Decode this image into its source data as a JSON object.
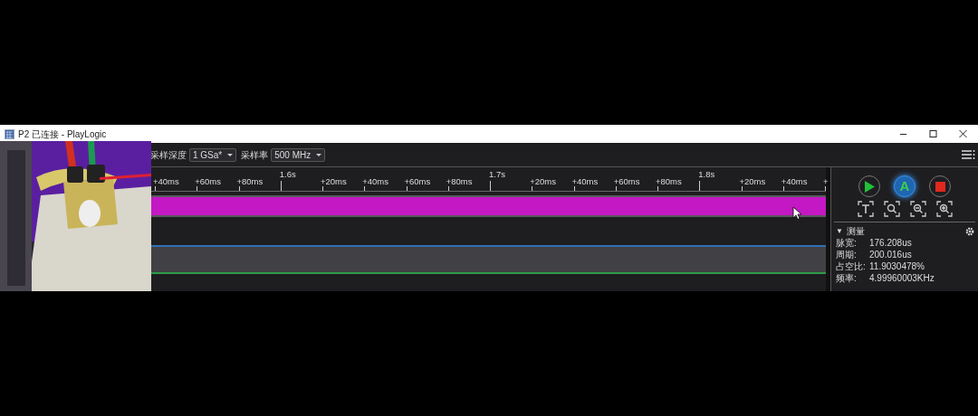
{
  "window": {
    "title": "P2 已连接 - PlayLogic"
  },
  "toolbar": {
    "fields": [
      {
        "label": "采样深度",
        "value": "1 GSa*"
      },
      {
        "label": "采样率",
        "value": "500 MHz"
      }
    ]
  },
  "ruler": {
    "ticks": [
      {
        "kind": "minor",
        "label": "+40ms"
      },
      {
        "kind": "minor",
        "label": "+60ms"
      },
      {
        "kind": "minor",
        "label": "+80ms"
      },
      {
        "kind": "major",
        "label": "1.6s"
      },
      {
        "kind": "minor",
        "label": "+20ms"
      },
      {
        "kind": "minor",
        "label": "+40ms"
      },
      {
        "kind": "minor",
        "label": "+60ms"
      },
      {
        "kind": "minor",
        "label": "+80ms"
      },
      {
        "kind": "major",
        "label": "1.7s"
      },
      {
        "kind": "minor",
        "label": "+20ms"
      },
      {
        "kind": "minor",
        "label": "+40ms"
      },
      {
        "kind": "minor",
        "label": "+60ms"
      },
      {
        "kind": "minor",
        "label": "+80ms"
      },
      {
        "kind": "major",
        "label": "1.8s"
      },
      {
        "kind": "minor",
        "label": "+20ms"
      },
      {
        "kind": "minor",
        "label": "+40ms"
      },
      {
        "kind": "minor",
        "label": "+"
      }
    ]
  },
  "channels": [
    {
      "kind": "dense",
      "color": "#c318c3",
      "selected": false
    },
    {
      "kind": "low",
      "color": "#2f6fb8",
      "selected": false
    },
    {
      "kind": "low",
      "color": "#2e9a48",
      "selected": true
    }
  ],
  "controls": {
    "auto_label": "A",
    "auto_active": true
  },
  "measure": {
    "toggle": "▼",
    "title": "测量",
    "expanded": true,
    "rows": [
      {
        "label": "脉宽:",
        "value": "176.208us"
      },
      {
        "label": "周期:",
        "value": "200.016us"
      },
      {
        "label": "占空比:",
        "value": "11.9030478%"
      },
      {
        "label": "频率:",
        "value": "4.99960003KHz"
      }
    ]
  }
}
